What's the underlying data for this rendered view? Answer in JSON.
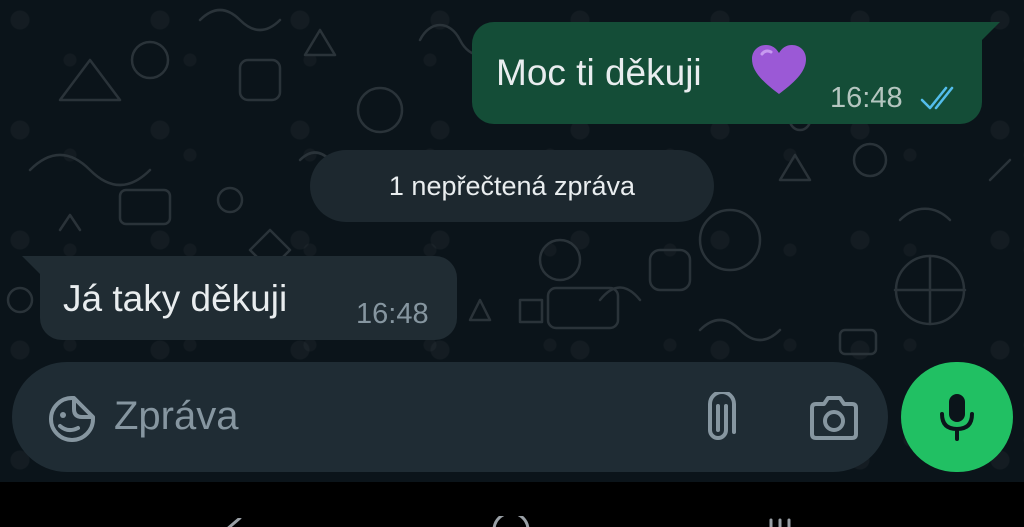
{
  "colors": {
    "chat_background": "#0b141a",
    "outgoing_bubble": "#144d37",
    "incoming_bubble": "#202c33",
    "composer_background": "#1f2c34",
    "accent_green": "#21c063",
    "read_ticks": "#53bdeb"
  },
  "messages": {
    "outgoing": {
      "text": "Moc ti děkuji",
      "emoji": "purple-heart",
      "time": "16:48",
      "status_icon": "double-check-read-icon"
    },
    "unread_divider": "1 nepřečtená zpráva",
    "incoming": {
      "text": "Já taky děkuji",
      "time": "16:48"
    }
  },
  "composer": {
    "placeholder": "Zpráva",
    "emoji_icon": "sticker-smiley-icon",
    "attach_icon": "paperclip-icon",
    "camera_icon": "camera-icon",
    "mic_icon": "microphone-icon"
  },
  "nav_bar": {
    "items": [
      "back-icon",
      "home-icon",
      "recents-icon"
    ]
  }
}
